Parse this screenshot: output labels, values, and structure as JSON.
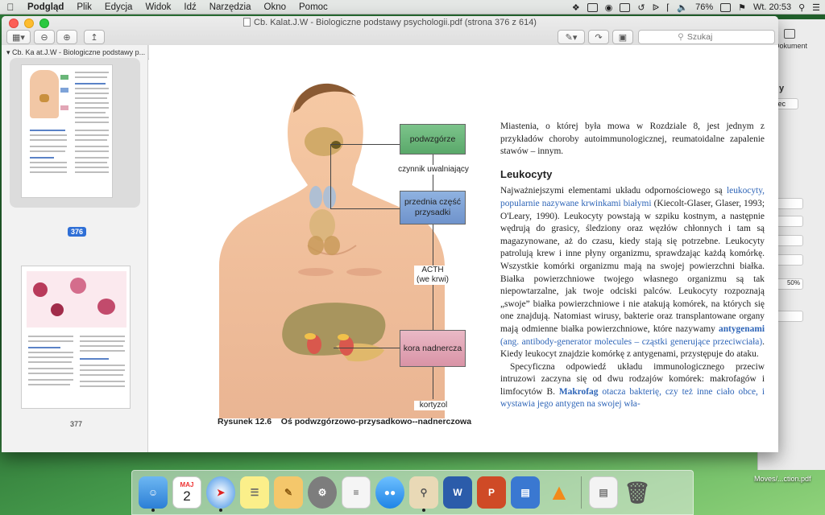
{
  "menubar": {
    "app": "Podgląd",
    "items": [
      "Plik",
      "Edycja",
      "Widok",
      "Idź",
      "Narzędzia",
      "Okno",
      "Pomoc"
    ],
    "battery": "76%",
    "clock": "Wt. 20:53"
  },
  "window": {
    "title": "Cb. Kalat.J.W - Biologiczne podstawy psychologii.pdf (strona 376 z 614)",
    "search_placeholder": "Szukaj"
  },
  "sidebar": {
    "document_name": "Cb. Ka at.J.W - Biologiczne podstawy p...",
    "pages": [
      {
        "label": "376",
        "selected": true
      },
      {
        "label": "377",
        "selected": false
      }
    ]
  },
  "figure": {
    "boxes": {
      "hypothalamus": "podwzgórze",
      "pituitary": "przednia część przysadki",
      "adrenal": "kora nadnercza"
    },
    "arrows": {
      "releasing_factor": "czynnik uwalniający",
      "acth": "ACTH (we krwi)",
      "cortisol": "kortyzol"
    },
    "caption_label": "Rysunek 12.6",
    "caption_text": "Oś podwzgórzowo-przysadkowo--nadnerczowa"
  },
  "text": {
    "p1": "Miastenia, o której była mowa w Rozdziale 8, jest jednym z przykładów choroby autoimmunologicznej, reumatoidalne zapalenie stawów – innym.",
    "heading": "Leukocyty",
    "p2_a": "Najważniejszymi elementami układu odpornościowego są ",
    "p2_link": "leukocyty, popularnie nazywane krwinkami białymi",
    "p2_b": " (Kiecolt-Glaser, Glaser, 1993; O'Leary, 1990). Leukocyty powstają w szpiku kostnym, a następnie wędrują do grasicy, śledziony oraz węzłów chłonnych i tam są magazynowane, aż do czasu, kiedy stają się potrzebne. Leukocyty patrolują krew i inne płyny organizmu, sprawdzając każdą komórkę. Wszystkie komórki organizmu mają na swojej powierzchni białka. Białka powierzchniowe twojego własnego organizmu są tak niepowtarzalne, jak twoje odciski palców. Leukocyty rozpoznają „swoje” białka powierzchniowe i nie atakują komórek, na których się one znajdują. Natomiast wirusy, bakterie oraz transplantowane organy mają odmienne białka powierzchniowe, które nazywamy ",
    "p2_term": "antygenami",
    "p2_c": " (ang. antibody-generator molecules – cząstki generujące przeciwciała)",
    "p2_d": ". Kiedy leukocyt znajdzie komórkę z antygenami, przystępuje do ataku.",
    "p3_a": "Specyficzna odpowiedź układu immunologicznego przeciw intruzowi zaczyna się od dwu rodzajów komórek: makrofagów i limfocytów B. ",
    "p3_term": "Makrofag",
    "p3_b": " otacza bakterię, czy też inne ciało obce, i wystawia jego antygen na swojej wła-"
  },
  "inspector": {
    "label_top": "Dokument",
    "button": "zec",
    "zoom": "50%"
  },
  "dock": {
    "calendar_month": "MAJ",
    "calendar_day": "2",
    "desktop_file": "Moves/...ction.pdf"
  },
  "colors": {
    "selection": "#2f6fd6",
    "link_blue": "#2d64b7",
    "box_green": "#6ab679",
    "box_blue": "#7ea3d8",
    "box_pink": "#e2a6b6"
  }
}
